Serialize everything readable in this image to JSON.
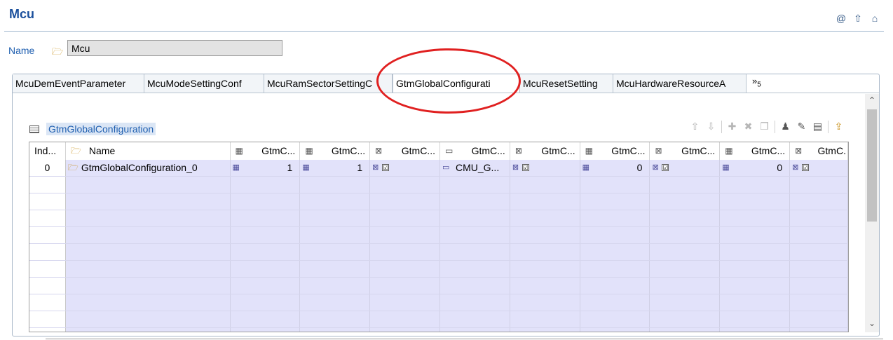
{
  "header": {
    "title": "Mcu",
    "icons": [
      "at-icon",
      "up-arrow-icon",
      "home-icon"
    ]
  },
  "name_field": {
    "label": "Name",
    "value": "Mcu"
  },
  "tabs": [
    {
      "label": "McuDemEventParameter"
    },
    {
      "label": "McuModeSettingConf"
    },
    {
      "label": "McuRamSectorSettingC"
    },
    {
      "label": "GtmGlobalConfigurati",
      "active": true
    },
    {
      "label": "McuResetSetting"
    },
    {
      "label": "McuHardwareResourceA"
    }
  ],
  "tabs_overflow": {
    "glyph": "»",
    "count": "5"
  },
  "section": {
    "title": "GtmGlobalConfiguration"
  },
  "table": {
    "columns": [
      {
        "label": "Ind..."
      },
      {
        "label": "Name"
      },
      {
        "label": "GtmC..."
      },
      {
        "label": "GtmC..."
      },
      {
        "label": "GtmC..."
      },
      {
        "label": "GtmC..."
      },
      {
        "label": "GtmC..."
      },
      {
        "label": "GtmC..."
      },
      {
        "label": "GtmC..."
      },
      {
        "label": "GtmC..."
      },
      {
        "label": "GtmC."
      }
    ],
    "rows": [
      {
        "index": "0",
        "name": "GtmGlobalConfiguration_0",
        "values": [
          "1",
          "1",
          "☑",
          "CMU_G...",
          "☑",
          "0",
          "☑",
          "0",
          "☑"
        ]
      }
    ]
  },
  "colors": {
    "accent": "#1f5fb0",
    "row_fill": "#e2e2fa",
    "highlight_ring": "#e02020"
  }
}
